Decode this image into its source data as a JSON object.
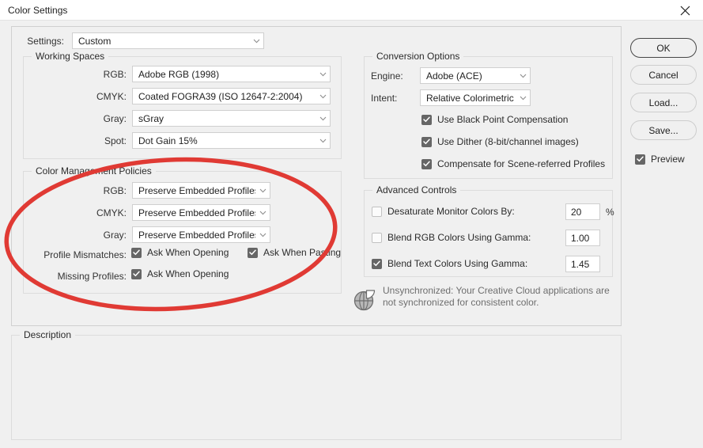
{
  "window": {
    "title": "Color Settings",
    "close_icon": "close-icon"
  },
  "settings_row": {
    "label": "Settings:",
    "value": "Custom"
  },
  "working_spaces": {
    "title": "Working Spaces",
    "rows": [
      {
        "label": "RGB:",
        "value": "Adobe RGB (1998)"
      },
      {
        "label": "CMYK:",
        "value": "Coated FOGRA39 (ISO 12647-2:2004)"
      },
      {
        "label": "Gray:",
        "value": "sGray"
      },
      {
        "label": "Spot:",
        "value": "Dot Gain 15%"
      }
    ]
  },
  "color_management_policies": {
    "title": "Color Management Policies",
    "rows": [
      {
        "label": "RGB:",
        "value": "Preserve Embedded Profiles"
      },
      {
        "label": "CMYK:",
        "value": "Preserve Embedded Profiles"
      },
      {
        "label": "Gray:",
        "value": "Preserve Embedded Profiles"
      }
    ],
    "profile_mismatches": {
      "label": "Profile Mismatches:",
      "ask_when_opening": "Ask When Opening",
      "ask_when_pasting": "Ask When Pasting"
    },
    "missing_profiles": {
      "label": "Missing Profiles:",
      "ask_when_opening": "Ask When Opening"
    }
  },
  "conversion_options": {
    "title": "Conversion Options",
    "engine": {
      "label": "Engine:",
      "value": "Adobe (ACE)"
    },
    "intent": {
      "label": "Intent:",
      "value": "Relative Colorimetric"
    },
    "checkboxes": [
      "Use Black Point Compensation",
      "Use Dither (8-bit/channel images)",
      "Compensate for Scene-referred Profiles"
    ]
  },
  "advanced_controls": {
    "title": "Advanced Controls",
    "rows": [
      {
        "label": "Desaturate Monitor Colors By:",
        "value": "20",
        "suffix": "%"
      },
      {
        "label": "Blend RGB Colors Using Gamma:",
        "value": "1.00",
        "suffix": ""
      },
      {
        "label": "Blend Text Colors Using Gamma:",
        "value": "1.45",
        "suffix": ""
      }
    ]
  },
  "sync_notice": {
    "icon": "color-sync-icon",
    "text": "Unsynchronized: Your Creative Cloud applications are not synchronized for consistent color."
  },
  "buttons": {
    "ok": "OK",
    "cancel": "Cancel",
    "load": "Load...",
    "save": "Save...",
    "preview": "Preview"
  },
  "description": {
    "title": "Description",
    "body": ""
  },
  "annotation": {
    "shape": "ellipse",
    "color": "#E03A34"
  },
  "colors": {
    "window_bg": "#f0f0f0",
    "titlebar_bg": "#ffffff",
    "field_bg": "#ffffff",
    "border": "#dcdcdc",
    "checkbox_on": "#666666",
    "annotation_red": "#E03A34"
  }
}
